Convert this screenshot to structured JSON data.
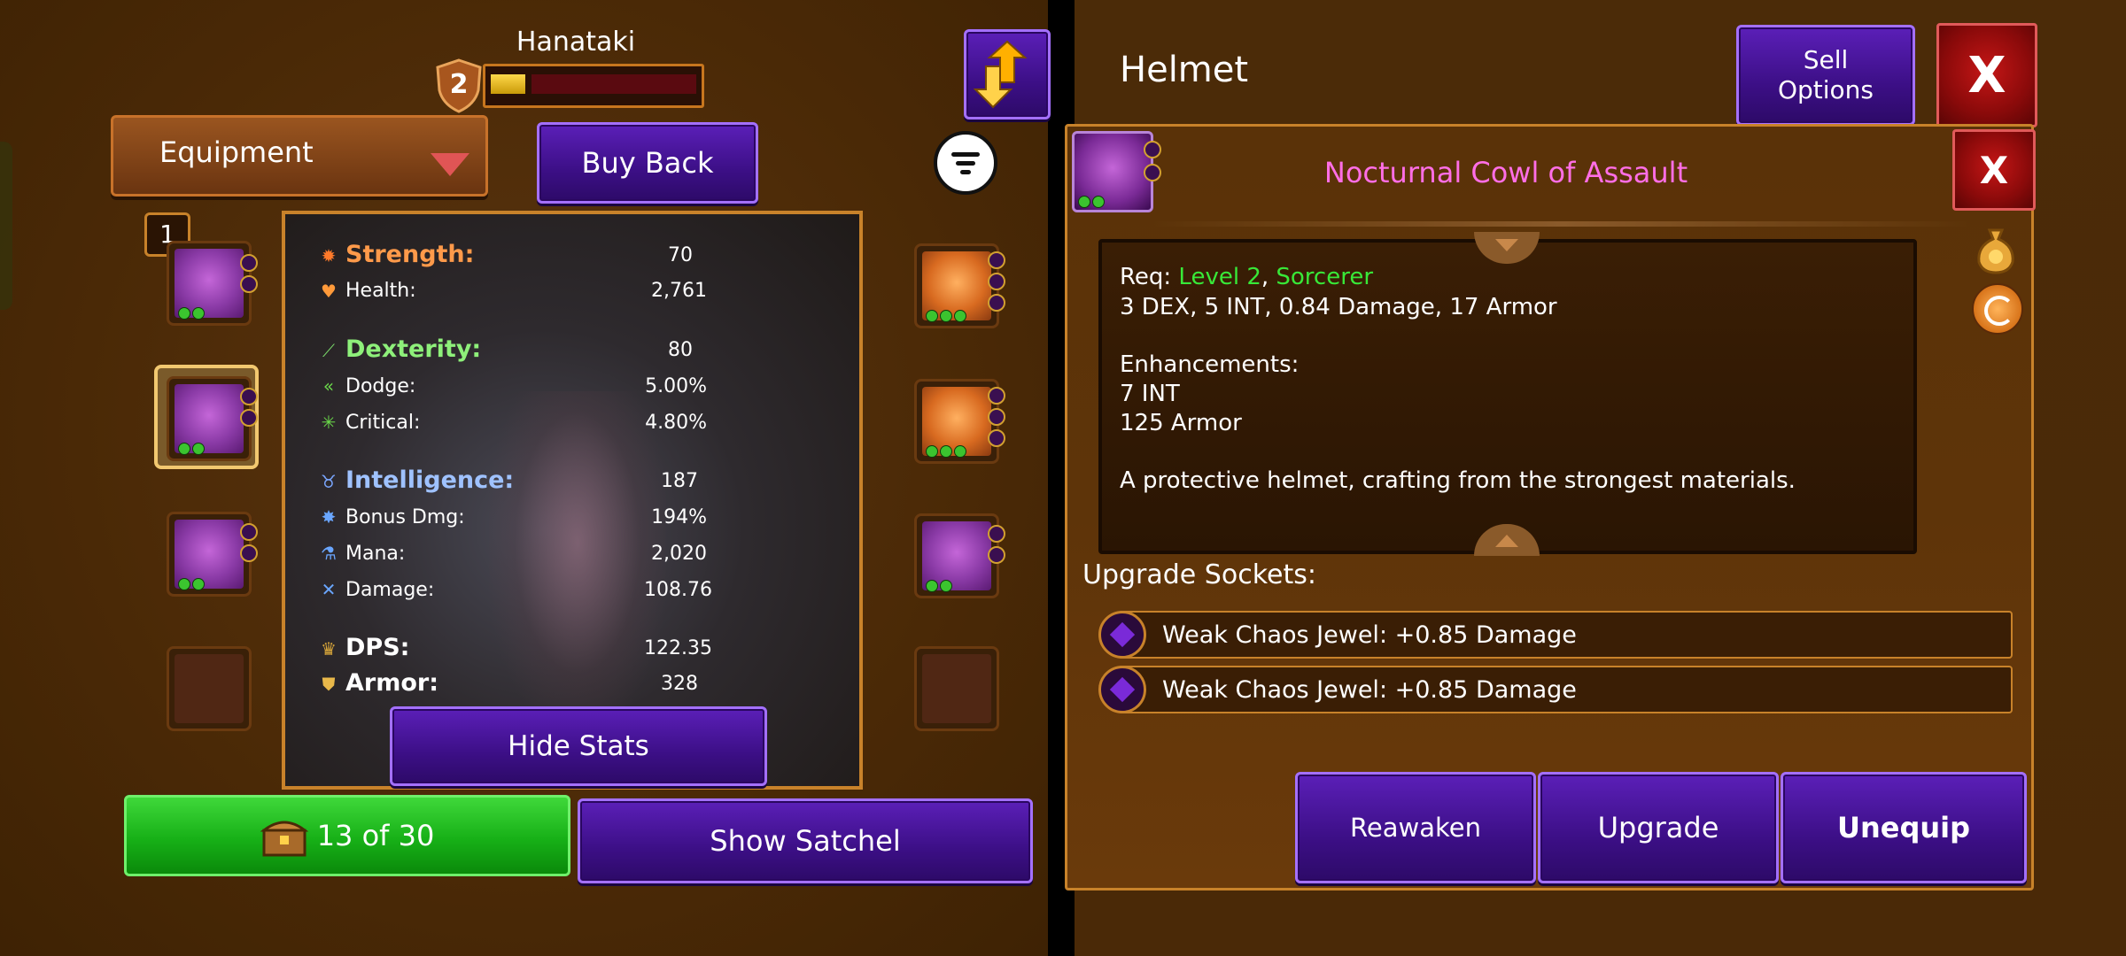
{
  "player": {
    "name": "Hanataki",
    "level": "2",
    "xp_fraction": 0.17
  },
  "left": {
    "dropdown": {
      "label": "Equipment"
    },
    "buy_back_label": "Buy Back",
    "slot_badge": "1",
    "hide_stats_label": "Hide Stats",
    "satchel_count": "13 of 30",
    "show_satchel_label": "Show Satchel"
  },
  "stats": {
    "strength": {
      "label": "Strength:",
      "value": "70"
    },
    "health": {
      "label": "Health:",
      "value": "2,761"
    },
    "dexterity": {
      "label": "Dexterity:",
      "value": "80"
    },
    "dodge": {
      "label": "Dodge:",
      "value": "5.00%"
    },
    "critical": {
      "label": "Critical:",
      "value": "4.80%"
    },
    "intelligence": {
      "label": "Intelligence:",
      "value": "187"
    },
    "bonus_dmg": {
      "label": "Bonus Dmg:",
      "value": "194%"
    },
    "mana": {
      "label": "Mana:",
      "value": "2,020"
    },
    "damage": {
      "label": "Damage:",
      "value": "108.76"
    },
    "dps": {
      "label": "DPS:",
      "value": "122.35"
    },
    "armor": {
      "label": "Armor:",
      "value": "328"
    }
  },
  "right": {
    "title": "Helmet",
    "sell_options_line1": "Sell",
    "sell_options_line2": "Options",
    "close_label": "X",
    "item_close_label": "X",
    "item_name": "Nocturnal Cowl of Assault",
    "req_prefix": "Req: ",
    "req_level": "Level 2",
    "req_sep": ", ",
    "req_class": "Sorcerer",
    "req_stats": "3 DEX, 5 INT, 0.84 Damage, 17 Armor",
    "enhancements_title": "Enhancements:",
    "enh_1": "7 INT",
    "enh_2": "125 Armor",
    "description": "A protective helmet, crafting from the strongest materials.",
    "upgrade_sockets_title": "Upgrade Sockets:",
    "sockets": [
      "Weak Chaos Jewel: +0.85 Damage",
      "Weak Chaos Jewel: +0.85 Damage"
    ],
    "reawaken_label": "Reawaken",
    "upgrade_label": "Upgrade",
    "unequip_label": "Unequip"
  },
  "colors": {
    "item_name": "#ff6ee6",
    "req_green": "#38e838",
    "strength": "#ff9a4a",
    "dexterity": "#8ef07a",
    "intelligence": "#9fc2ff"
  },
  "icons": [
    "swap-arrows-icon",
    "filter-icon",
    "treasure-chest-icon",
    "gold-bag-icon",
    "recycle-icon"
  ]
}
